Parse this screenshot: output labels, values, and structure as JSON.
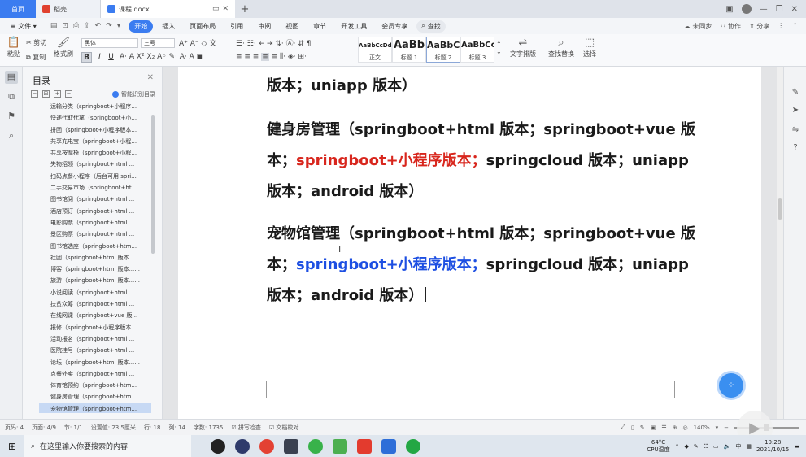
{
  "tabs": {
    "home": "首页",
    "t2": "稻壳",
    "t3": "课程.docx"
  },
  "menubar": {
    "file": "文件",
    "items": [
      "开始",
      "插入",
      "页面布局",
      "引用",
      "审阅",
      "视图",
      "章节",
      "开发工具",
      "会员专享"
    ],
    "search": "查找",
    "right": [
      "未同步",
      "协作",
      "分享"
    ]
  },
  "ribbon": {
    "paste": "粘贴",
    "cut": "剪切",
    "copy": "复制",
    "format_painter": "格式刷",
    "font_name": "黑体",
    "font_size": "三号",
    "styles": [
      {
        "sample": "AaBbCcDd",
        "label": "正文"
      },
      {
        "sample": "AaBb",
        "label": "标题 1"
      },
      {
        "sample": "AaBbC",
        "label": "标题 2"
      },
      {
        "sample": "AaBbCc",
        "label": "标题 3"
      }
    ],
    "text_layout": "文字排版",
    "find_replace": "查找替换",
    "select": "选择"
  },
  "toc": {
    "title": "目录",
    "smart": "智能识别目录",
    "items": [
      "运输分类（springboot+小程序...",
      "快递代取代拿（springboot+小...",
      "拼团（springboot+小程序版本...",
      "共享充电宝（springboot+小程...",
      "共享按摩椅（springboot+小程...",
      "失物招领（springboot+html ...",
      "扫码点餐小程序（后台可用 spri...",
      "二手交易市场（springboot+ht...",
      "图书馆阅（springboot+html ...",
      "酒店预订（springboot+html ...",
      "电影购票（springboot+html ...",
      "景区购票（springboot+html ...",
      "图书馆选座（springboot+htm...",
      "社团（springboot+html 版本......",
      "博客（springboot+html 版本......",
      "旅游（springboot+html 版本......",
      "小说阅读（springboot+html ...",
      "扶贫众筹（springboot+html ...",
      "在线网课（springboot+vue 版...",
      "报修（springboot+小程序版本...",
      "活动报名（springboot+html ...",
      "医院挂号（springboot+html ...",
      "论坛（springboot+html 版本......",
      "点餐外卖（springboot+html ...",
      "体育馆预约（springboot+htm...",
      "健身房管理（springboot+htm...",
      "宠物馆管理（springboot+htm..."
    ]
  },
  "doc": {
    "p1_line1": "版本；uniapp 版本）",
    "p2_line1": "健身房管理（springboot+html 版本；springboot+vue 版",
    "p2_line2_a": "本；",
    "p2_line2_red": "springboot+小程序版本；",
    "p2_line2_b": "springcloud 版本；uniapp",
    "p2_line3": "版本；android 版本）",
    "p3_line1": "宠物馆管理（springboot+html 版本；springboot+vue 版",
    "p3_line2_a": "本；",
    "p3_line2_blue": "springboot+小程序版本；",
    "p3_line2_b": "springcloud 版本；uniapp",
    "p3_line3": "版本；android 版本）"
  },
  "status": {
    "page_num": "页码: 4",
    "page": "页面: 4/9",
    "section": "节: 1/1",
    "position": "设置值: 23.5厘米",
    "row": "行: 18",
    "col": "列: 14",
    "words": "字数: 1735",
    "spell": "拼写检查",
    "proof": "文档校对",
    "zoom": "140%"
  },
  "taskbar": {
    "search_placeholder": "在这里输入你要搜索的内容",
    "temp": "64°C",
    "temp_label": "CPU温度",
    "ime": "中",
    "time": "10:28",
    "date": "2021/10/15"
  },
  "colors": {
    "accent": "#3b7cf0",
    "red_text": "#d8261d",
    "blue_text": "#1d4fe2"
  }
}
